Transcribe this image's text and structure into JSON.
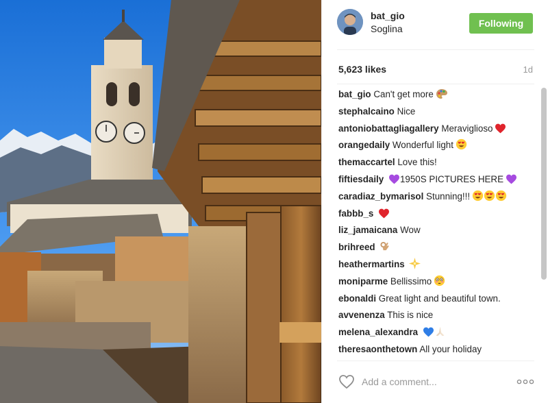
{
  "post": {
    "username": "bat_gio",
    "location": "Soglina",
    "follow_label": "Following",
    "likes": "5,623 likes",
    "time": "1d"
  },
  "comments": [
    {
      "user": "bat_gio",
      "text": "Can't get more",
      "emoji": "palette"
    },
    {
      "user": "stephalcaino",
      "text": "Nice",
      "emoji": ""
    },
    {
      "user": "antoniobattagliagallery",
      "text": "Meraviglioso",
      "emoji": "red-heart"
    },
    {
      "user": "orangedaily",
      "text": "Wonderful light",
      "emoji": "heart-eyes"
    },
    {
      "user": "themaccartel",
      "text": "Love this!",
      "emoji": ""
    },
    {
      "user": "fiftiesdaily",
      "text": "1950S PICTURES HERE",
      "emoji": "purple-hearts"
    },
    {
      "user": "caradiaz_bymarisol",
      "text": "Stunning!!!",
      "emoji": "heart-eyes-x3"
    },
    {
      "user": "fabbb_s",
      "text": "",
      "emoji": "red-heart"
    },
    {
      "user": "liz_jamaicana",
      "text": "Wow",
      "emoji": ""
    },
    {
      "user": "brihreed",
      "text": "",
      "emoji": "ok-hand"
    },
    {
      "user": "heathermartins",
      "text": "",
      "emoji": "sparkle"
    },
    {
      "user": "moniparme",
      "text": "Bellissimo",
      "emoji": "flushed"
    },
    {
      "user": "ebonaldi",
      "text": "Great light and beautiful town.",
      "emoji": ""
    },
    {
      "user": "avvenenza",
      "text": "This is nice",
      "emoji": ""
    },
    {
      "user": "melena_alexandra",
      "text": "",
      "emoji": "blue-heart-hands"
    },
    {
      "user": "theresaonthetown",
      "text": "All your holiday",
      "emoji": ""
    }
  ],
  "comment_box": {
    "placeholder": "Add a comment..."
  },
  "colors": {
    "follow_bg": "#70c050",
    "sky": "#2d7de0",
    "text": "#262626",
    "muted": "#999999"
  },
  "icons": [
    "heart-outline-icon",
    "more-options-icon",
    "palette-icon",
    "red-heart-icon",
    "heart-eyes-icon",
    "purple-heart-icon",
    "ok-hand-icon",
    "sparkle-icon",
    "flushed-face-icon",
    "blue-heart-icon",
    "praying-hands-icon"
  ]
}
